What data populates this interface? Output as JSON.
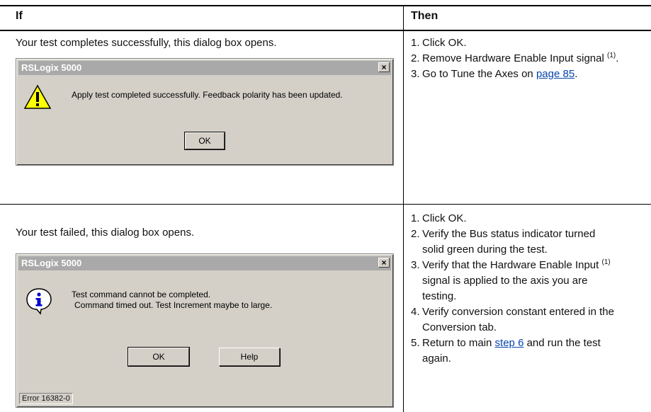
{
  "table": {
    "header_if": "If",
    "header_then": "Then",
    "rows": [
      {
        "if_text": "Your test completes successfully, this dialog box opens.",
        "dialog": {
          "title": "RSLogix 5000",
          "close_glyph": "×",
          "message": "Apply test completed successfully. Feedback polarity has been updated.",
          "ok_label": "OK"
        },
        "steps": [
          {
            "num": "1.",
            "text": "Click OK."
          },
          {
            "num": "2.",
            "text": "Remove Hardware Enable Input signal",
            "sup": "(1)",
            "after": "."
          },
          {
            "num": "3.",
            "text": "Go to Tune the Axes on ",
            "link": "page 85",
            "after": "."
          }
        ]
      },
      {
        "if_text": "Your test failed, this dialog box opens.",
        "dialog": {
          "title": "RSLogix 5000",
          "close_glyph": "×",
          "message_line1": "Test command cannot be completed.",
          "message_line2": "Command timed out. Test Increment maybe to large.",
          "ok_label": "OK",
          "help_label": "Help",
          "status": "Error 16382-0"
        },
        "steps": [
          {
            "num": "1.",
            "text": "Click OK."
          },
          {
            "num": "2.",
            "line1": "Verify the Bus status indicator turned",
            "line2": "solid green during the test."
          },
          {
            "num": "3.",
            "line1": "Verify that the Hardware Enable Input",
            "sup": "(1)",
            "line2": "signal is applied to the axis you are",
            "line3": "testing."
          },
          {
            "num": "4.",
            "line1": "Verify conversion constant entered in the",
            "line2": "Conversion tab."
          },
          {
            "num": "5.",
            "line1a": "Return to main ",
            "link": "step 6",
            "line1b": " and run the test",
            "line2": "again."
          }
        ]
      }
    ]
  },
  "colors": {
    "warning_fill": "#ffff00",
    "info_fill": "#ffffff",
    "info_glyph": "#0000cc",
    "dialog_face": "#d4d0c8",
    "title_bar": "#a9a9a9",
    "link": "#0645ad"
  },
  "icons": {
    "warning": "warning-triangle-icon",
    "info": "info-icon",
    "close": "close-icon"
  }
}
